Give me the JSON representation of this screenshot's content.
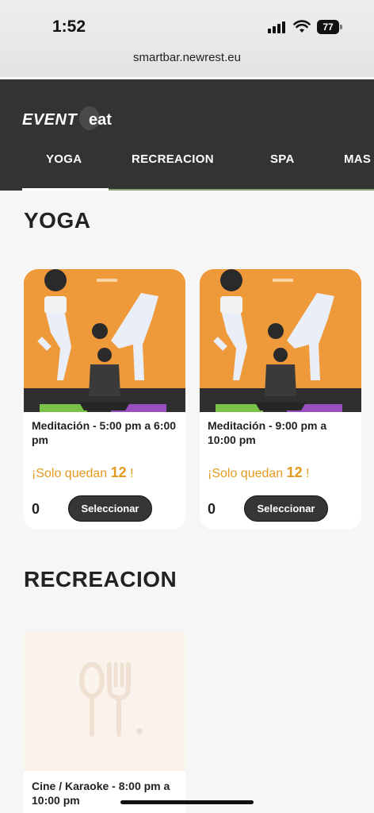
{
  "status_bar": {
    "time": "1:52",
    "battery": "77"
  },
  "browser": {
    "url": "smartbar.newrest.eu"
  },
  "brand": {
    "logo_part1": "EVENT",
    "logo_part2": "eat"
  },
  "tabs": [
    {
      "label": "YOGA",
      "active": true
    },
    {
      "label": "RECREACION"
    },
    {
      "label": "SPA"
    },
    {
      "label": "MAS"
    }
  ],
  "sections": {
    "yoga": {
      "title": "YOGA",
      "cards": [
        {
          "title": "Meditación - 5:00 pm a 6:00 pm",
          "stock_prefix": "¡Solo quedan",
          "stock_count": "12",
          "stock_suffix": "!",
          "qty": "0",
          "button": "Seleccionar"
        },
        {
          "title": "Meditación - 9:00 pm a 10:00 pm",
          "stock_prefix": "¡Solo quedan",
          "stock_count": "12",
          "stock_suffix": "!",
          "qty": "0",
          "button": "Seleccionar"
        }
      ]
    },
    "recreacion": {
      "title": "RECREACION",
      "cards": [
        {
          "title": "Cine / Karaoke - 8:00 pm a 10:00 pm",
          "icon": "fork-spoon-icon"
        }
      ]
    }
  },
  "colors": {
    "header": "#333333",
    "accent": "#e49a1e",
    "tab_line": "#8aa074",
    "image_bg": "#ee9a3a"
  }
}
